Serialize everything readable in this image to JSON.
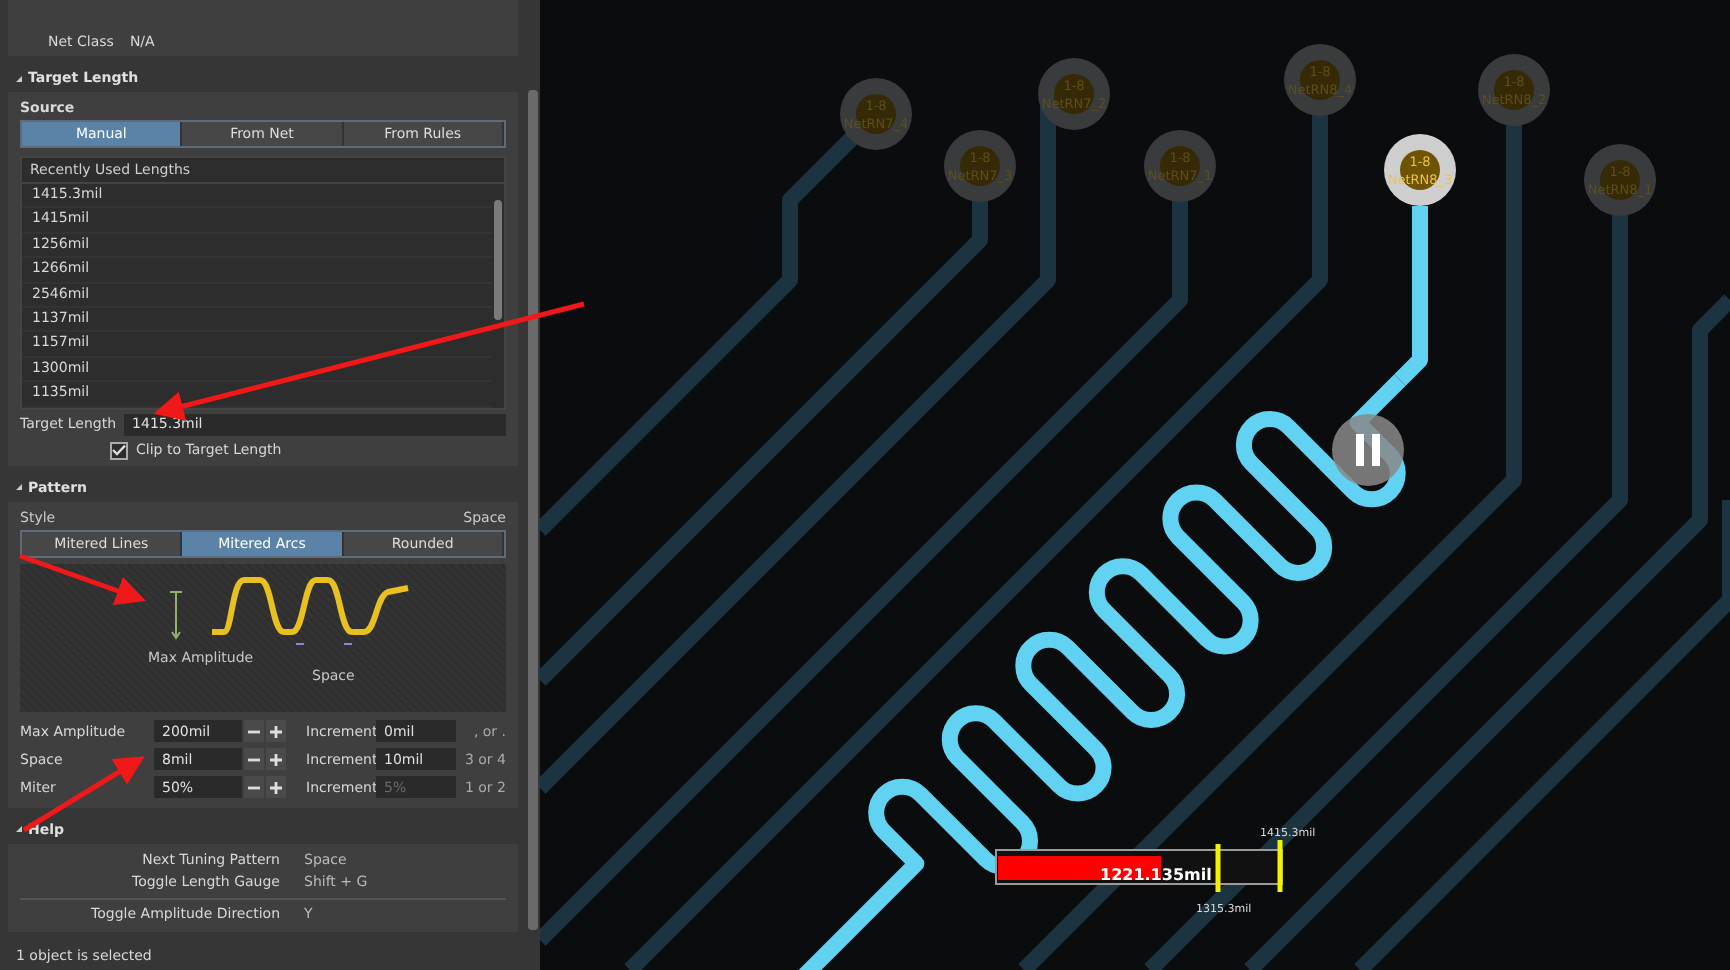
{
  "properties": {
    "rows": [
      {
        "label": "Net Class",
        "value": "N/A"
      }
    ]
  },
  "target_length": {
    "title": "Target Length",
    "source_label": "Source",
    "source_tabs": [
      {
        "label": "Manual",
        "selected": true
      },
      {
        "label": "From Net",
        "selected": false
      },
      {
        "label": "From Rules",
        "selected": false
      }
    ],
    "list_header": "Recently Used Lengths",
    "lengths": [
      "1415.3mil",
      "1415mil",
      "1256mil",
      "1266mil",
      "2546mil",
      "1137mil",
      "1157mil",
      "1300mil",
      "1135mil"
    ],
    "field_label": "Target Length",
    "field_value": "1415.3mil",
    "clip": {
      "label": "Clip to Target Length",
      "checked": true
    }
  },
  "pattern": {
    "title": "Pattern",
    "style_label": "Style",
    "style_hint": "Space",
    "style_tabs": [
      {
        "label": "Mitered Lines",
        "selected": false
      },
      {
        "label": "Mitered Arcs",
        "selected": true
      },
      {
        "label": "Rounded",
        "selected": false
      }
    ],
    "diagram": {
      "amplitude_label": "Max Amplitude",
      "space_label": "Space"
    },
    "params": [
      {
        "label": "Max Amplitude",
        "value": "200mil",
        "increment_label": "Increment",
        "increment": "0mil",
        "increment_disabled": false,
        "hint": ", or ."
      },
      {
        "label": "Space",
        "value": "8mil",
        "increment_label": "Increment",
        "increment": "10mil",
        "increment_disabled": false,
        "hint": "3 or 4"
      },
      {
        "label": "Miter",
        "value": "50%",
        "increment_label": "Increment",
        "increment": "5%",
        "increment_disabled": true,
        "hint": "1 or 2"
      }
    ]
  },
  "help": {
    "title": "Help",
    "shortcut_groups": [
      [
        {
          "action": "Next Tuning Pattern",
          "key": "Space"
        },
        {
          "action": "Toggle Length Gauge",
          "key": "Shift + G"
        }
      ],
      [
        {
          "action": "Toggle Amplitude Direction",
          "key": "Y"
        }
      ]
    ]
  },
  "status_bar": "1 object is selected",
  "board": {
    "pads": [
      {
        "number": "1-8",
        "net": "NetRN7_4",
        "selected": false
      },
      {
        "number": "1-8",
        "net": "NetRN7_3",
        "selected": false
      },
      {
        "number": "1-8",
        "net": "NetRN7_2",
        "selected": false
      },
      {
        "number": "1-8",
        "net": "NetRN7_1",
        "selected": false
      },
      {
        "number": "1-8",
        "net": "NetRN8_4",
        "selected": false
      },
      {
        "number": "1-8",
        "net": "NetRN8_3",
        "selected": true
      },
      {
        "number": "1-8",
        "net": "NetRN8_2",
        "selected": false
      },
      {
        "number": "1-8",
        "net": "NetRN8_1",
        "selected": false
      }
    ],
    "gauge": {
      "level": 0.57,
      "value": "1221.135mil",
      "target": "1415.3mil",
      "lower": "1315.3mil"
    }
  }
}
